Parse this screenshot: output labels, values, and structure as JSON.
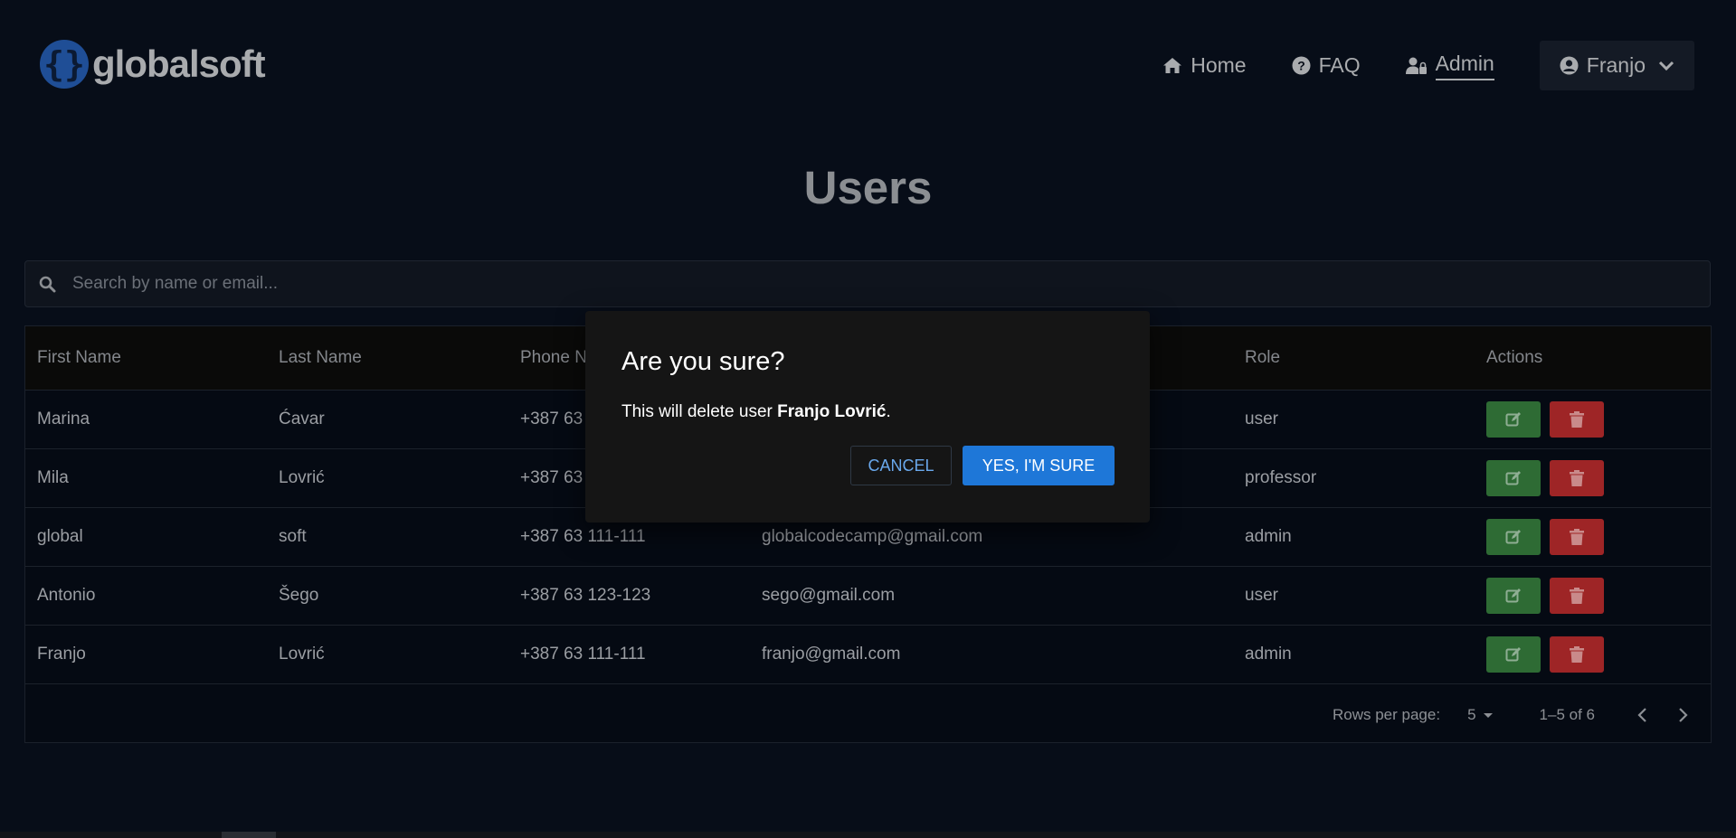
{
  "brand": {
    "name": "globalsoft",
    "logo_glyph": "{}"
  },
  "nav": {
    "items": [
      {
        "label": "Home",
        "icon": "home-icon"
      },
      {
        "label": "FAQ",
        "icon": "question-circle-icon"
      },
      {
        "label": "Admin",
        "icon": "user-lock-icon",
        "active": true
      }
    ],
    "user": {
      "label": "Franjo",
      "icon": "user-circle-icon"
    }
  },
  "page": {
    "title": "Users"
  },
  "search": {
    "placeholder": "Search by name or email..."
  },
  "table": {
    "columns": [
      "First Name",
      "Last Name",
      "Phone N",
      "Role",
      "Actions"
    ],
    "rows": [
      {
        "first": "Marina",
        "last": "Ćavar",
        "phone": "+387 63",
        "email": "",
        "role": "user"
      },
      {
        "first": "Mila",
        "last": "Lovrić",
        "phone": "+387 63",
        "email": "",
        "role": "professor"
      },
      {
        "first": "global",
        "last": "soft",
        "phone": "+387 63 111-111",
        "email": "globalcodecamp@gmail.com",
        "role": "admin"
      },
      {
        "first": "Antonio",
        "last": "Šego",
        "phone": "+387 63 123-123",
        "email": "sego@gmail.com",
        "role": "user"
      },
      {
        "first": "Franjo",
        "last": "Lovrić",
        "phone": "+387 63 111-111",
        "email": "franjo@gmail.com",
        "role": "admin"
      }
    ]
  },
  "pagination": {
    "rows_label": "Rows per page:",
    "rows_value": "5",
    "range": "1–5 of 6"
  },
  "dialog": {
    "title": "Are you sure?",
    "message_prefix": "This will delete user ",
    "message_name": "Franjo Lovrić",
    "message_suffix": ".",
    "cancel_label": "CANCEL",
    "confirm_label": "YES, I'M SURE"
  },
  "colors": {
    "background": "#070d18",
    "primary": "#1e77d8",
    "edit": "#2e6b34",
    "delete": "#9e2526"
  }
}
